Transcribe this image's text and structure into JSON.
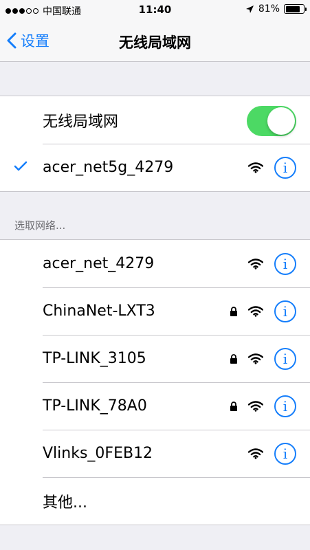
{
  "status_bar": {
    "carrier": "中国联通",
    "time": "11:40",
    "battery_pct": "81%",
    "battery_level": 0.81,
    "signal_dots_filled": 3,
    "signal_dots_total": 5
  },
  "nav": {
    "back_label": "设置",
    "title": "无线局域网"
  },
  "wlan": {
    "toggle_label": "无线局域网",
    "toggle_on": true,
    "connected_network": "acer_net5g_4279"
  },
  "section_header": "选取网络...",
  "networks": [
    {
      "name": "acer_net_4279",
      "locked": false
    },
    {
      "name": "ChinaNet-LXT3",
      "locked": true
    },
    {
      "name": "TP-LINK_3105",
      "locked": true
    },
    {
      "name": "TP-LINK_78A0",
      "locked": true
    },
    {
      "name": "Vlinks_0FEB12",
      "locked": false
    }
  ],
  "other_label": "其他...",
  "info_glyph": "i",
  "colors": {
    "accent": "#157efb",
    "toggle_on": "#4cd964",
    "background": "#efeff4"
  }
}
